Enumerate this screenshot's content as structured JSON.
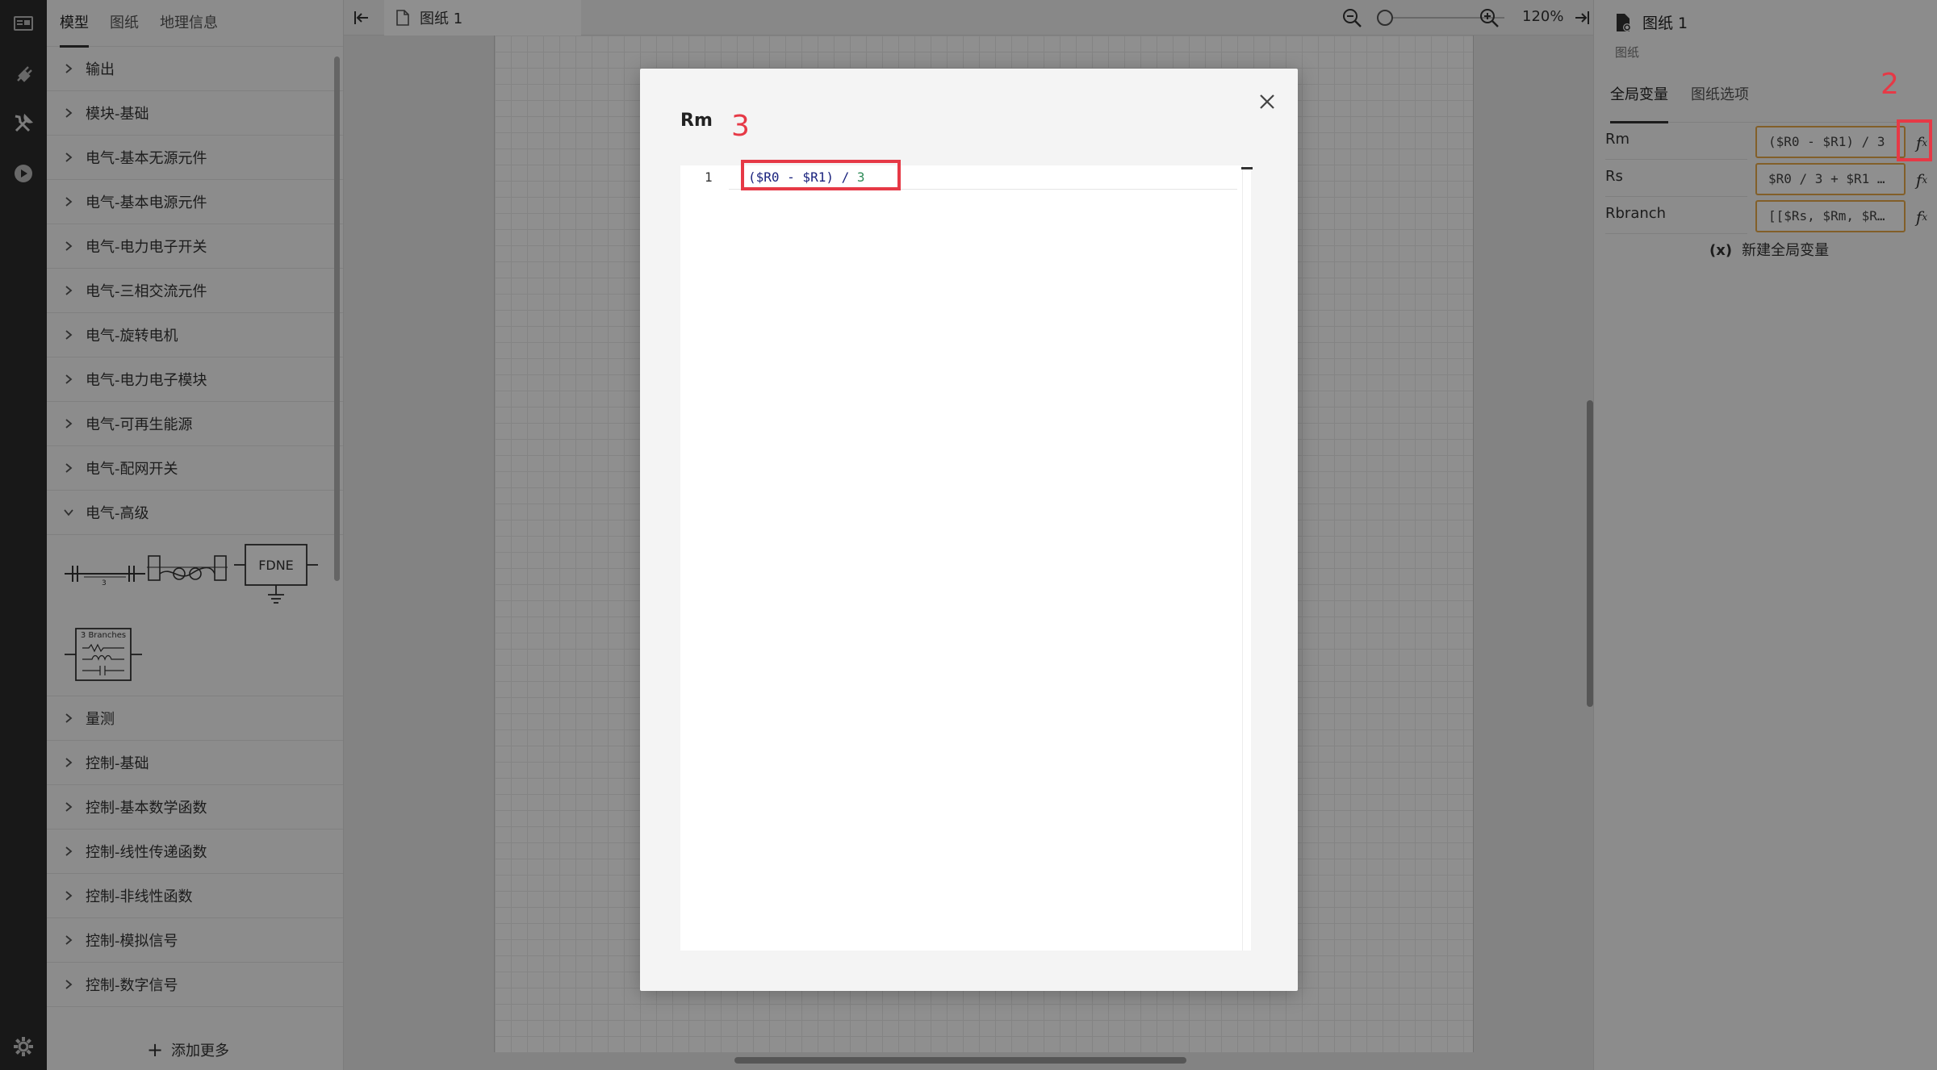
{
  "left_panel": {
    "tabs": [
      "模型",
      "图纸",
      "地理信息"
    ],
    "active_tab": "模型",
    "categories_top": [
      "输出",
      "模块-基础",
      "电气-基本无源元件",
      "电气-基本电源元件",
      "电气-电力电子开关",
      "电气-三相交流元件",
      "电气-旋转电机",
      "电气-电力电子模块",
      "电气-可再生能源",
      "电气-配网开关"
    ],
    "expanded_category": "电气-高级",
    "component_labels": {
      "fdne": "FDNE",
      "branches": "3 Branches",
      "num": "3"
    },
    "categories_bottom": [
      "量测",
      "控制-基础",
      "控制-基本数学函数",
      "控制-线性传递函数",
      "控制-非线性函数",
      "控制-模拟信号",
      "控制-数字信号"
    ],
    "add_more": "添加更多"
  },
  "center": {
    "doc_tab": "图纸 1",
    "zoom": "120%"
  },
  "right_panel": {
    "title": "图纸 1",
    "subtitle": "图纸",
    "tabs": [
      "全局变量",
      "图纸选项"
    ],
    "active_tab": "全局变量",
    "variables": [
      {
        "name": "Rm",
        "value": "($R0 - $R1) / 3"
      },
      {
        "name": "Rs",
        "value": "$R0 / 3 + $R1 *…"
      },
      {
        "name": "Rbranch",
        "value": "[[$Rs, $Rm, $Rm…"
      }
    ],
    "new_var_prefix": "(x)",
    "new_var": "新建全局变量",
    "fx_label": "f",
    "fx_sub": "x"
  },
  "modal": {
    "title": "Rm",
    "line_number": "1",
    "code_text": "($R0 - $R1) / ",
    "code_number": "3"
  },
  "annotations": {
    "a2": "2",
    "a3": "3"
  },
  "colors": {
    "highlight": "#e63946",
    "input_border": "#e8a94a",
    "rail": "#2c2c2c"
  }
}
